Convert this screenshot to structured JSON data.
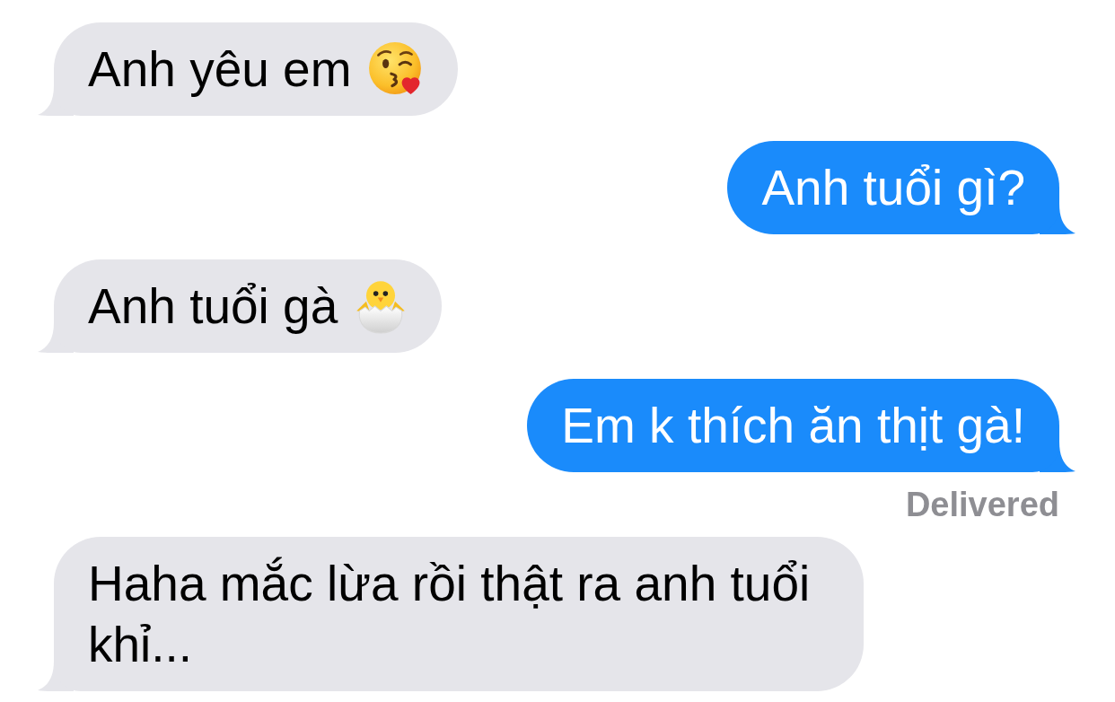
{
  "messages": [
    {
      "kind": "incoming",
      "parts": [
        {
          "kind": "text",
          "text": "Anh yêu em"
        },
        {
          "kind": "kiss_emoji"
        }
      ]
    },
    {
      "kind": "outgoing",
      "parts": [
        {
          "kind": "text",
          "text": "Anh tuổi gì?"
        }
      ]
    },
    {
      "kind": "incoming",
      "parts": [
        {
          "kind": "text",
          "text": "Anh tuổi gà"
        },
        {
          "kind": "chick_emoji"
        }
      ]
    },
    {
      "kind": "outgoing",
      "parts": [
        {
          "kind": "text",
          "text": "Em k thích ăn thịt gà!"
        }
      ],
      "receipt": "Delivered"
    },
    {
      "kind": "incoming",
      "parts": [
        {
          "kind": "text",
          "text": "Haha mắc lừa rồi thật ra anh tuổi khỉ..."
        }
      ]
    }
  ]
}
